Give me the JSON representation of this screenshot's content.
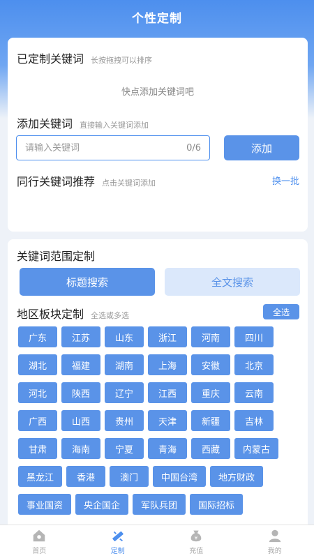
{
  "header": {
    "title": "个性定制"
  },
  "customized": {
    "title": "已定制关键词",
    "hint": "长按拖拽可以排序",
    "empty_text": "快点添加关键词吧"
  },
  "add_keyword": {
    "title": "添加关键词",
    "hint": "直接输入关键词添加",
    "placeholder": "请输入关键词",
    "counter": "0/6",
    "button": "添加"
  },
  "peer": {
    "title": "同行关键词推荐",
    "hint": "点击关键词添加",
    "refresh": "换一批"
  },
  "scope": {
    "title": "关键词范围定制",
    "tabs": [
      {
        "label": "标题搜索",
        "active": true
      },
      {
        "label": "全文搜索",
        "active": false
      }
    ]
  },
  "region": {
    "title": "地区板块定制",
    "hint": "全选或多选",
    "select_all": "全选",
    "items": [
      "广东",
      "江苏",
      "山东",
      "浙江",
      "河南",
      "四川",
      "湖北",
      "福建",
      "湖南",
      "上海",
      "安徽",
      "北京",
      "河北",
      "陕西",
      "辽宁",
      "江西",
      "重庆",
      "云南",
      "广西",
      "山西",
      "贵州",
      "天津",
      "新疆",
      "吉林",
      "甘肃",
      "海南",
      "宁夏",
      "青海",
      "西藏",
      "内蒙古",
      "黑龙江",
      "香港",
      "澳门",
      "中国台湾",
      "地方财政",
      "事业国资",
      "央企国企",
      "军队兵团",
      "国际招标"
    ]
  },
  "tabbar": [
    {
      "label": "首页",
      "icon": "home-icon",
      "active": false
    },
    {
      "label": "定制",
      "icon": "customize-icon",
      "active": true
    },
    {
      "label": "充值",
      "icon": "recharge-icon",
      "active": false
    },
    {
      "label": "我的",
      "icon": "user-icon",
      "active": false
    }
  ],
  "colors": {
    "primary": "#5a93e8",
    "header": "#4d8fee",
    "light": "#dbe8fb"
  }
}
